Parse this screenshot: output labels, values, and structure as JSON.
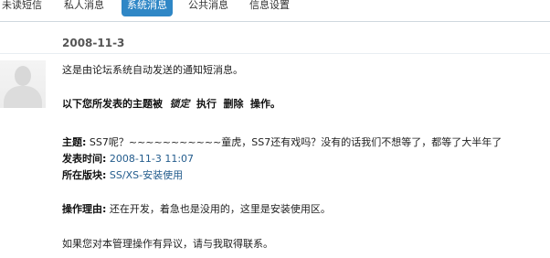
{
  "tabs": {
    "unread": "未读短信",
    "private": "私人消息",
    "system": "系统消息",
    "public": "公共消息",
    "settings": "信息设置"
  },
  "message": {
    "date": "2008-11-3",
    "line1": "这是由论坛系统自动发送的通知短消息。",
    "line2_prefix": "以下您所发表的主题被",
    "op_fancy": "锁定",
    "op_execute": "执行",
    "op_delete": "删除",
    "op_suffix": "操作。",
    "topic_label": "主题:",
    "topic_value": "SS7呢？~~~~~~~~~~~童虎，SS7还有戏吗？没有的话我们不想等了，都等了大半年了",
    "time_label": "发表时间:",
    "time_value": "2008-11-3 11:07",
    "board_label": "所在版块:",
    "board_value": "SS/XS-安装使用",
    "reason_label": "操作理由:",
    "reason_value": "还在开发，着急也是没用的，这里是安装使用区。",
    "footer": "如果您对本管理操作有异议，请与我取得联系。"
  }
}
